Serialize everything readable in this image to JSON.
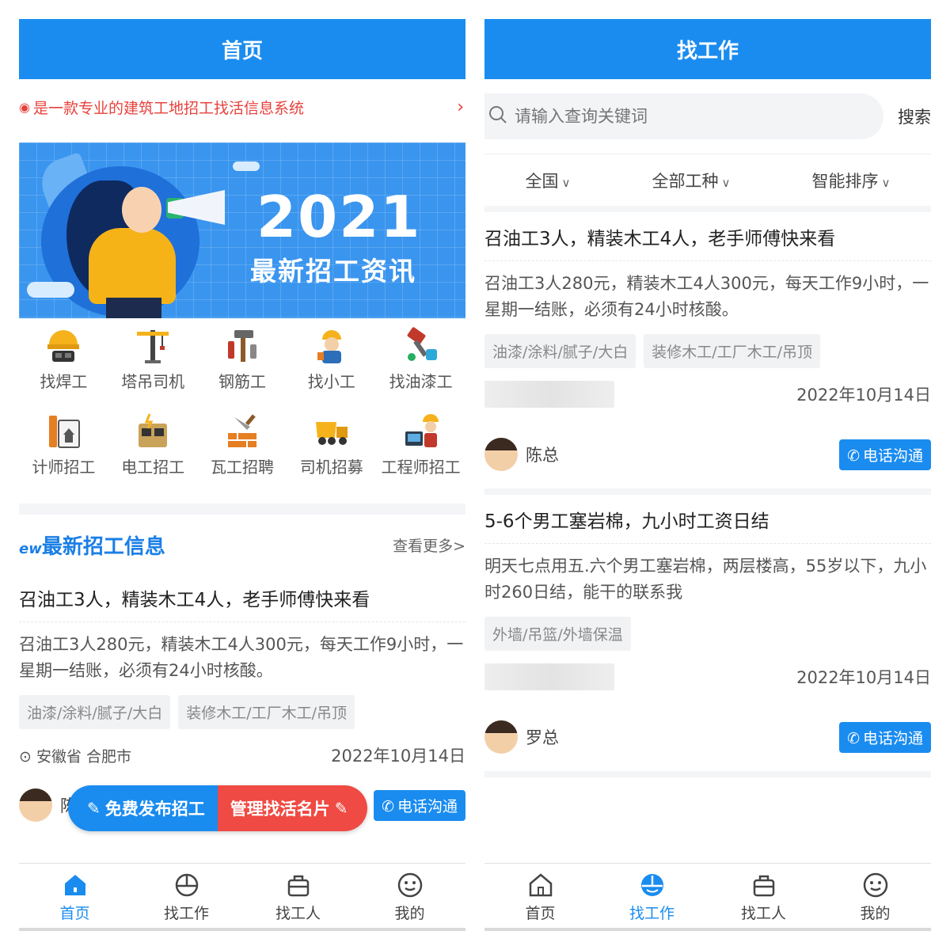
{
  "left": {
    "header_title": "首页",
    "marquee_text": "是一款专业的建筑工地招工找活信息系统",
    "banner": {
      "year": "2021",
      "title": "最新招工资讯"
    },
    "categories": [
      {
        "label": "找焊工",
        "icon": "welder-helmet-icon"
      },
      {
        "label": "塔吊司机",
        "icon": "tower-crane-icon"
      },
      {
        "label": "钢筋工",
        "icon": "tools-icon"
      },
      {
        "label": "找小工",
        "icon": "worker-icon"
      },
      {
        "label": "找油漆工",
        "icon": "paint-brush-icon"
      },
      {
        "label": "计师招工",
        "icon": "designer-icon"
      },
      {
        "label": "电工招工",
        "icon": "electric-box-icon"
      },
      {
        "label": "瓦工招聘",
        "icon": "bricklayer-icon"
      },
      {
        "label": "司机招募",
        "icon": "truck-icon"
      },
      {
        "label": "工程师招工",
        "icon": "engineer-icon"
      }
    ],
    "section": {
      "badge": "ew",
      "title": "最新招工信息",
      "more": "查看更多>"
    },
    "job": {
      "title": "召油工3人，精装木工4人，老手师傅快来看",
      "desc": "召油工3人280元，精装木工4人300元，每天工作9小时，一星期一结账，必须有24小时核酸。",
      "tags": [
        "油漆/涂料/腻子/大白",
        "装修木工/工厂木工/吊顶"
      ],
      "location": "安徽省 合肥市",
      "date": "2022年10月14日",
      "person": "陈总",
      "call": "电话沟通"
    },
    "float_buttons": {
      "publish": "免费发布招工",
      "manage": "管理找活名片"
    },
    "tabs": [
      "首页",
      "找工作",
      "找工人",
      "我的"
    ]
  },
  "right": {
    "header_title": "找工作",
    "search": {
      "placeholder": "请输入查询关键词",
      "button": "搜索"
    },
    "filters": [
      "全国",
      "全部工种",
      "智能排序"
    ],
    "jobs": [
      {
        "title": "召油工3人，精装木工4人，老手师傅快来看",
        "desc": "召油工3人280元，精装木工4人300元，每天工作9小时，一星期一结账，必须有24小时核酸。",
        "tags": [
          "油漆/涂料/腻子/大白",
          "装修木工/工厂木工/吊顶"
        ],
        "date": "2022年10月14日",
        "person": "陈总",
        "call": "电话沟通"
      },
      {
        "title": "5-6个男工塞岩棉，九小时工资日结",
        "desc": "明天七点用五.六个男工塞岩棉，两层楼高，55岁以下，九小时260日结，能干的联系我",
        "tags": [
          "外墙/吊篮/外墙保温"
        ],
        "date": "2022年10月14日",
        "person": "罗总",
        "call": "电话沟通"
      }
    ],
    "tabs": [
      "首页",
      "找工作",
      "找工人",
      "我的"
    ]
  },
  "colors": {
    "primary": "#1a8cf0",
    "accent_red": "#ef4a43"
  }
}
